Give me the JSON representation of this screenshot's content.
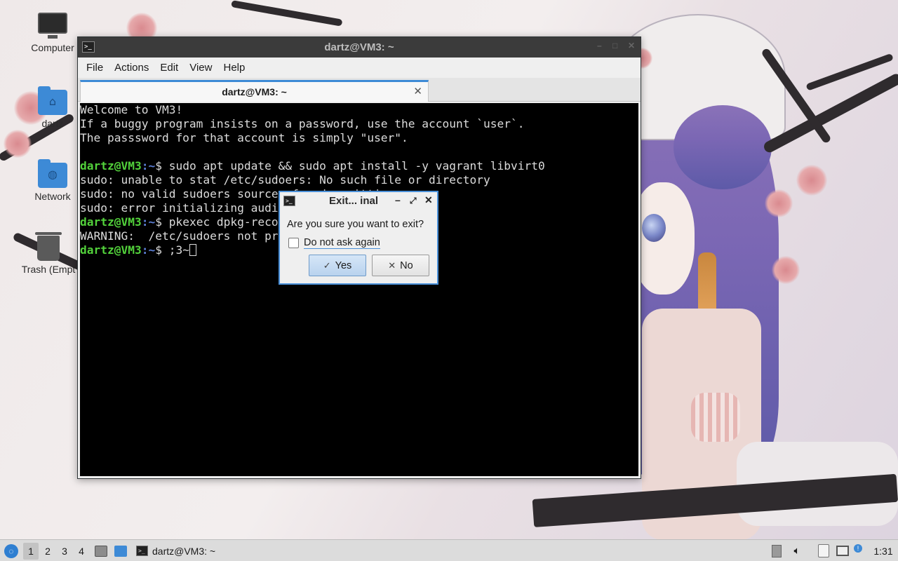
{
  "desktop": {
    "icons": [
      {
        "label": "Computer",
        "icon": "computer-icon"
      },
      {
        "label": "dartz",
        "icon": "home-folder-icon"
      },
      {
        "label": "Network",
        "icon": "network-folder-icon"
      },
      {
        "label": "Trash (Empt",
        "icon": "trash-icon"
      }
    ]
  },
  "terminal_window": {
    "title": "dartz@VM3: ~",
    "menu": [
      "File",
      "Actions",
      "Edit",
      "View",
      "Help"
    ],
    "tab_title": "dartz@VM3: ~",
    "lines": [
      {
        "type": "text",
        "text": "Welcome to VM3!"
      },
      {
        "type": "text",
        "text": "If a buggy program insists on a password, use the account `user`."
      },
      {
        "type": "text",
        "text": "The passsword for that account is simply \"user\"."
      },
      {
        "type": "text",
        "text": ""
      },
      {
        "type": "prompt",
        "user": "dartz@VM3",
        "path": ":~",
        "cmd": "$ sudo apt update && sudo apt install -y vagrant libvirt0"
      },
      {
        "type": "text",
        "text": "sudo: unable to stat /etc/sudoers: No such file or directory"
      },
      {
        "type": "text",
        "text": "sudo: no valid sudoers sources found, quitting"
      },
      {
        "type": "text",
        "text": "sudo: error initializing audit plugin sudoers_audit"
      },
      {
        "type": "prompt",
        "user": "dartz@VM3",
        "path": ":~",
        "cmd": "$ pkexec dpkg-reconfigure sudo"
      },
      {
        "type": "text",
        "text": "WARNING:  /etc/sudoers not present!"
      },
      {
        "type": "prompt",
        "user": "dartz@VM3",
        "path": ":~",
        "cmd": "$ ;3~",
        "cursor": true
      }
    ]
  },
  "dialog": {
    "title": "Exit... inal",
    "message": "Are you sure you want to exit?",
    "checkbox_label": "Do not ask again",
    "checkbox_checked": false,
    "yes_label": "Yes",
    "no_label": "No"
  },
  "taskbar": {
    "workspaces": [
      "1",
      "2",
      "3",
      "4"
    ],
    "active_workspace": "1",
    "task_label": "dartz@VM3: ~",
    "clock": "1:31"
  },
  "colors": {
    "prompt_user": "#52d13b",
    "prompt_path": "#5c7fd6",
    "accent": "#4a90d9"
  }
}
